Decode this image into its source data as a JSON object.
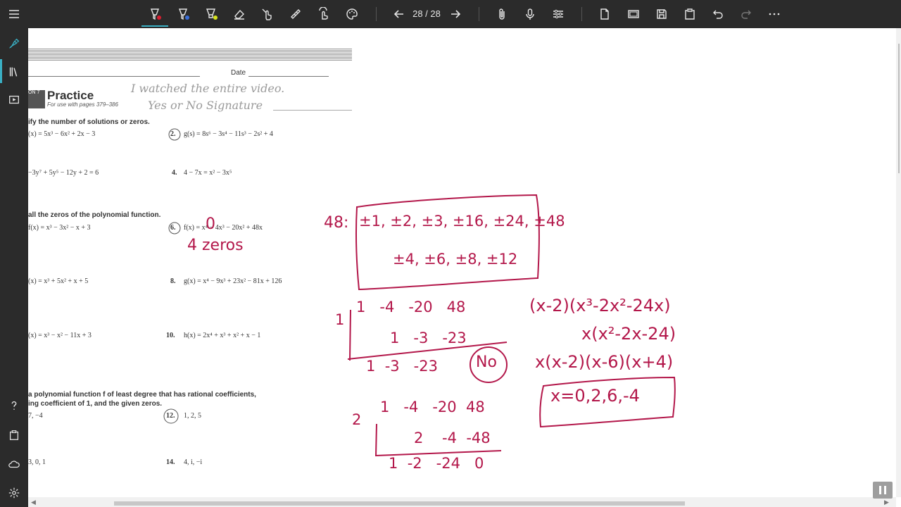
{
  "toolbar": {
    "page_indicator": "28 / 28",
    "tools": [
      "pen-red",
      "pen-blue",
      "highlighter-yellow",
      "eraser",
      "touch-select",
      "ruler",
      "touch-writing",
      "palette"
    ],
    "right_tools": [
      "attach",
      "microphone",
      "adjust",
      "new-page",
      "screen",
      "save",
      "clipboard",
      "undo",
      "redo",
      "more"
    ],
    "colors": {
      "red": "#d91e30",
      "blue": "#3b6fd8",
      "yellow": "#d7e31c",
      "accent": "#3ab0c4",
      "ink": "#b3174a"
    }
  },
  "sidebar": {
    "items": [
      "pen-icon",
      "library-icon",
      "slideshow-icon"
    ],
    "bottom_items": [
      "help-icon",
      "clipboard-icon",
      "cloud-icon",
      "settings-icon"
    ]
  },
  "worksheet": {
    "date_label": "Date",
    "lesson_tag": "ON 7",
    "title": "Practice",
    "subtitle": "For use with pages 379–386",
    "handwritten_note_1": "I watched the entire video.",
    "handwritten_note_2": "Yes or No  Signature",
    "section1": "ify the number of solutions or zeros.",
    "problems": [
      {
        "num": "",
        "text": "(x) = 5x³ − 6x² + 2x − 3"
      },
      {
        "num": "2.",
        "text": "g(s) = 8s⁶ − 3s⁴ − 11s³ − 2s² + 4"
      },
      {
        "num": "",
        "text": "−3y⁷ + 5y⁵ − 12y + 2 = 6"
      },
      {
        "num": "4.",
        "text": "4 − 7x = x² − 3x⁵"
      }
    ],
    "section2": "all the zeros of the polynomial function.",
    "problems2": [
      {
        "num": "",
        "text": "f(x) = x³ − 3x² − x + 3"
      },
      {
        "num": "6.",
        "text": "f(x) = x⁴ − 4x³ − 20x² + 48x"
      },
      {
        "num": "",
        "text": "(x) = x³ + 5x² + x + 5"
      },
      {
        "num": "8.",
        "text": "g(x) = x⁴ − 9x³ + 23x² − 81x + 126"
      },
      {
        "num": "",
        "text": "(x) = x³ − x² − 11x + 3"
      },
      {
        "num": "10.",
        "text": "h(x) = 2x⁴ + x³ + x² + x − 1"
      }
    ],
    "section3_line1": "a polynomial function f of least degree that has rational coefficients,",
    "section3_line2": "ing coefficient of 1, and the given zeros.",
    "problems3": [
      {
        "num": "",
        "text": "7, −4"
      },
      {
        "num": "12.",
        "text": "1, 2, 5"
      },
      {
        "num": "",
        "text": "3, 0, 1"
      },
      {
        "num": "14.",
        "text": "4, i, −i"
      }
    ]
  },
  "handwriting": {
    "zero_mark": "0",
    "four_zeros": "4 zeros",
    "factors_label": "48:",
    "factors_row1": "±1, ±2, ±3, ±16, ±24, ±48",
    "factors_row2": "±4, ±6, ±8, ±12",
    "syn1_divisor": "1",
    "syn1_row1": "1   -4   -20   48",
    "syn1_row2": "1   -3   -23",
    "syn1_row3": "1  -3   -23",
    "syn1_result": "No",
    "syn2_divisor": "2",
    "syn2_row1": "1   -4   -20  48",
    "syn2_row2": "2    -4  -48",
    "syn2_row3": "1  -2   -24   0",
    "factor_line1": "(x-2)(x³-2x²-24x)",
    "factor_line2": "x(x²-2x-24)",
    "factor_line3": "x(x-2)(x-6)(x+4)",
    "answer": "x=0,2,6,-4"
  }
}
